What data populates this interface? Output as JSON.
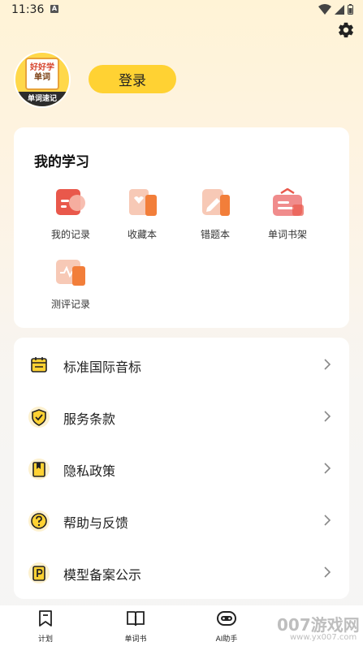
{
  "status_bar": {
    "time": "11:36",
    "notif_letter": "A"
  },
  "profile": {
    "avatar_line1": "好好学",
    "avatar_line2": "单词",
    "avatar_ribbon": "单词速记",
    "login_label": "登录"
  },
  "study": {
    "title": "我的学习",
    "items": [
      {
        "label": "我的记录",
        "icon": "record-icon"
      },
      {
        "label": "收藏本",
        "icon": "favorites-icon"
      },
      {
        "label": "错题本",
        "icon": "mistakes-icon"
      },
      {
        "label": "单词书架",
        "icon": "bookshelf-icon"
      },
      {
        "label": "测评记录",
        "icon": "assessment-icon"
      }
    ]
  },
  "menu": {
    "items": [
      {
        "label": "标准国际音标",
        "icon": "calendar-icon"
      },
      {
        "label": "服务条款",
        "icon": "shield-check-icon"
      },
      {
        "label": "隐私政策",
        "icon": "bookmark-icon"
      },
      {
        "label": "帮助与反馈",
        "icon": "question-icon"
      },
      {
        "label": "模型备案公示",
        "icon": "p-badge-icon"
      }
    ]
  },
  "tabbar": {
    "tabs": [
      {
        "label": "计划",
        "icon": "plan-icon"
      },
      {
        "label": "单词书",
        "icon": "wordbook-icon"
      },
      {
        "label": "AI助手",
        "icon": "ai-robot-icon"
      }
    ]
  },
  "watermark": {
    "text": "007游戏网",
    "url": "www.yx007.com"
  },
  "colors": {
    "accent": "#FFD233",
    "icon_orange": "#F27E3A",
    "icon_bg": "#FDF1CF"
  }
}
